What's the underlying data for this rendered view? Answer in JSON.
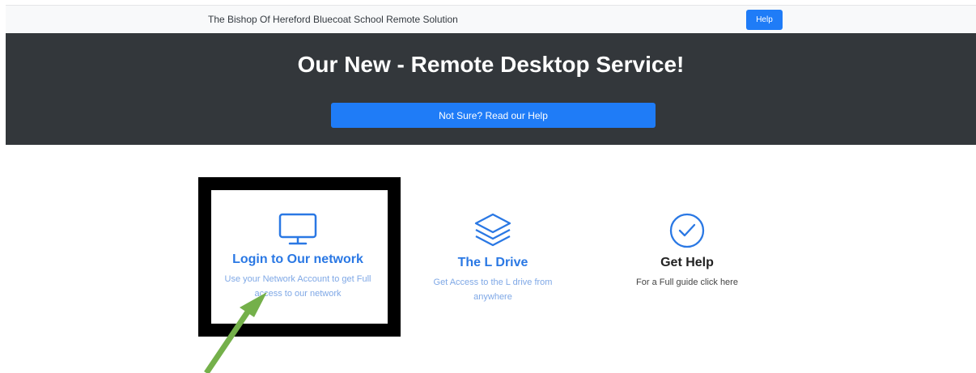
{
  "header": {
    "brand": "The Bishop Of Hereford Bluecoat School Remote Solution",
    "help_label": "Help"
  },
  "hero": {
    "title": "Our New - Remote Desktop Service!",
    "button_label": "Not Sure? Read our Help"
  },
  "cards": [
    {
      "icon": "monitor-icon",
      "title": "Login to Our network",
      "desc_line1": "Use your Network Account to get Full",
      "desc_line2": "access to our network"
    },
    {
      "icon": "layers-icon",
      "title": "The L Drive",
      "desc_line1": "Get Access to the L drive from",
      "desc_line2": "anywhere"
    },
    {
      "icon": "check-circle-icon",
      "title": "Get Help",
      "desc_line1": "For a Full guide click here"
    }
  ],
  "annotation": {
    "box_color": "#000000",
    "arrow_color": "#74b04a"
  },
  "colors": {
    "accent": "#1f7cf7",
    "hero_bg": "#33373b",
    "link": "#2a78e4"
  }
}
